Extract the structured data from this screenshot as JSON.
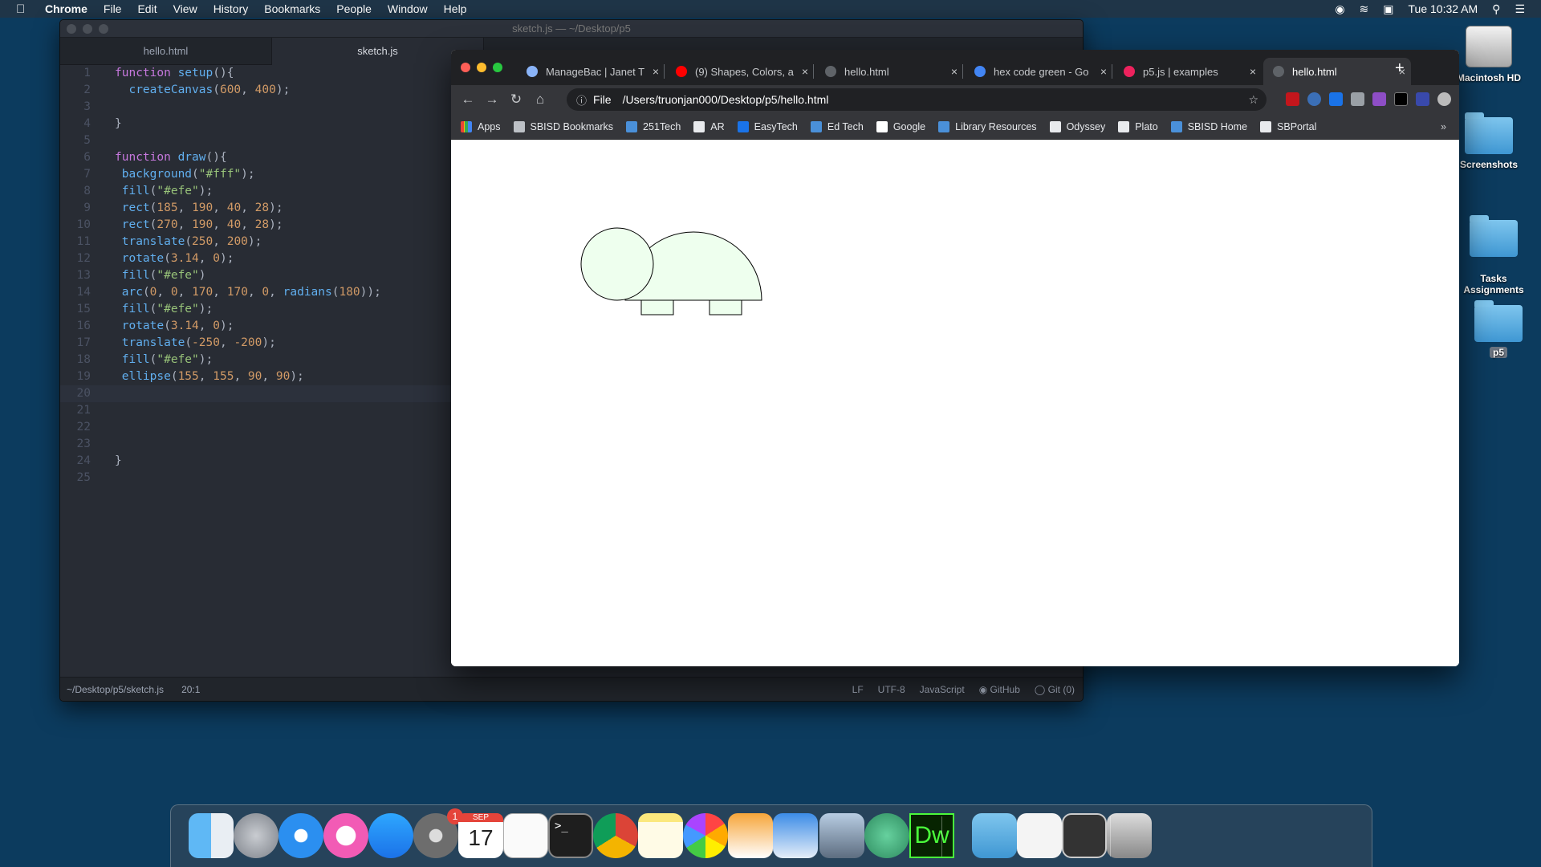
{
  "menubar": {
    "app": "Chrome",
    "items": [
      "File",
      "Edit",
      "View",
      "History",
      "Bookmarks",
      "People",
      "Window",
      "Help"
    ],
    "clock": "Tue 10:32 AM"
  },
  "desktop": {
    "icons": [
      "Macintosh HD",
      "Screenshots",
      "Tasks\nAssignments",
      "p5"
    ]
  },
  "atom": {
    "title": "sketch.js — ~/Desktop/p5",
    "tabs": [
      "hello.html",
      "sketch.js"
    ],
    "active_tab": "sketch.js",
    "status": {
      "path": "~/Desktop/p5/sketch.js",
      "cursor": "20:1",
      "eol": "LF",
      "encoding": "UTF-8",
      "grammar": "JavaScript",
      "github": "GitHub",
      "git": "Git (0)"
    },
    "code_lines": [
      "function setup(){",
      "  createCanvas(600, 400);",
      "",
      "}",
      "",
      "function draw(){",
      " background(\"#fff\");",
      " fill(\"#efe\");",
      " rect(185, 190, 40, 28);",
      " rect(270, 190, 40, 28);",
      " translate(250, 200);",
      " rotate(3.14, 0);",
      " fill(\"#efe\")",
      " arc(0, 0, 170, 170, 0, radians(180));",
      " fill(\"#efe\");",
      " rotate(3.14, 0);",
      " translate(-250, -200);",
      " fill(\"#efe\");",
      " ellipse(155, 155, 90, 90);",
      "",
      "",
      "",
      "",
      "}",
      ""
    ],
    "current_line": 20
  },
  "chrome": {
    "tabs": [
      {
        "title": "ManageBac | Janet T",
        "color": "#8ab4f8"
      },
      {
        "title": "(9) Shapes, Colors, a",
        "color": "#ff0000"
      },
      {
        "title": "hello.html",
        "color": "#5f6368"
      },
      {
        "title": "hex code green - Go",
        "color": "#4285f4"
      },
      {
        "title": "p5.js | examples",
        "color": "#ed225d"
      },
      {
        "title": "hello.html",
        "color": "#5f6368"
      }
    ],
    "active_tab_index": 5,
    "address": {
      "scheme": "File",
      "url": "/Users/truonjan000/Desktop/p5/hello.html"
    },
    "bookmarks": [
      "Apps",
      "SBISD Bookmarks",
      "251Tech",
      "AR",
      "EasyTech",
      "Ed Tech",
      "Google",
      "Library Resources",
      "Odyssey",
      "Plato",
      "SBISD Home",
      "SBPortal"
    ],
    "canvas_fill": "#efe"
  },
  "dock": {
    "apps": [
      "Finder",
      "Launchpad",
      "Safari",
      "iTunes",
      "App Store",
      "System Preferences",
      "Calendar",
      "TextEdit",
      "Terminal",
      "Chrome",
      "Notes",
      "Photos",
      "Pages",
      "Keynote",
      "Preview",
      "Atom",
      "Dreamweaver",
      "Applications",
      "Documents",
      "Screenshot",
      "Trash"
    ],
    "calendar_month": "SEP",
    "calendar_day": "17",
    "sysprefs_badge": "1",
    "dw_label": "Dw"
  }
}
